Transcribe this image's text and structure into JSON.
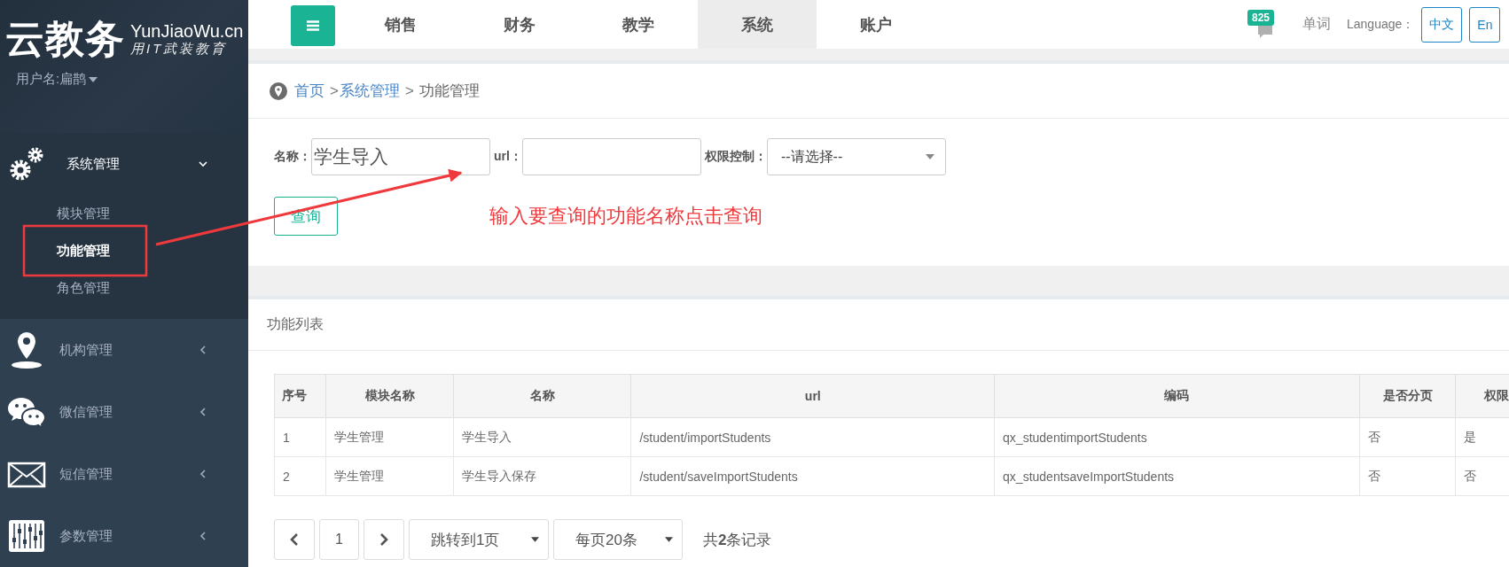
{
  "logo": {
    "title": "云教务",
    "domain": "YunJiaoWu.cn",
    "slogan": "用IT武装教育"
  },
  "user": {
    "label": "用户名:扁鹊"
  },
  "sidebar": {
    "items": [
      {
        "label": "系统管理",
        "expanded": true,
        "children": [
          {
            "label": "模块管理",
            "selected": false
          },
          {
            "label": "功能管理",
            "selected": true
          },
          {
            "label": "角色管理",
            "selected": false
          }
        ]
      },
      {
        "label": "机构管理",
        "expanded": false
      },
      {
        "label": "微信管理",
        "expanded": false
      },
      {
        "label": "短信管理",
        "expanded": false
      },
      {
        "label": "参数管理",
        "expanded": false
      }
    ]
  },
  "topnav": {
    "tabs": [
      {
        "label": "销售",
        "selected": false
      },
      {
        "label": "财务",
        "selected": false
      },
      {
        "label": "教学",
        "selected": false
      },
      {
        "label": "系统",
        "selected": true
      },
      {
        "label": "账户",
        "selected": false
      }
    ],
    "badge": "825",
    "word_link": "单词",
    "language_label": "Language：",
    "languages": [
      "中文",
      "En"
    ]
  },
  "breadcrumb": {
    "separator": ">",
    "items": [
      {
        "label": "首页",
        "link": true
      },
      {
        "label": "系统管理",
        "link": true
      },
      {
        "label": "功能管理",
        "link": false
      }
    ]
  },
  "search": {
    "fields": [
      {
        "label": "名称：",
        "kind": "text",
        "value": "学生导入"
      },
      {
        "label": "url：",
        "kind": "text"
      },
      {
        "label": "权限控制：",
        "kind": "select",
        "value": "--请选择--"
      }
    ],
    "button": "查询"
  },
  "annotation": {
    "text": "输入要查询的功能名称点击查询"
  },
  "table": {
    "title": "功能列表",
    "columns": [
      "序号",
      "模块名称",
      "名称",
      "url",
      "编码",
      "是否分页",
      "权限"
    ],
    "rows": [
      [
        "1",
        "学生管理",
        "学生导入",
        "/student/importStudents",
        "qx_studentimportStudents",
        "否",
        "是"
      ],
      [
        "2",
        "学生管理",
        "学生导入保存",
        "/student/saveImportStudents",
        "qx_studentsaveImportStudents",
        "否",
        "否"
      ]
    ]
  },
  "pagination": {
    "page": "1",
    "jump": "跳转到1页",
    "per_page": "每页20条",
    "total": "共**2**条记录"
  }
}
